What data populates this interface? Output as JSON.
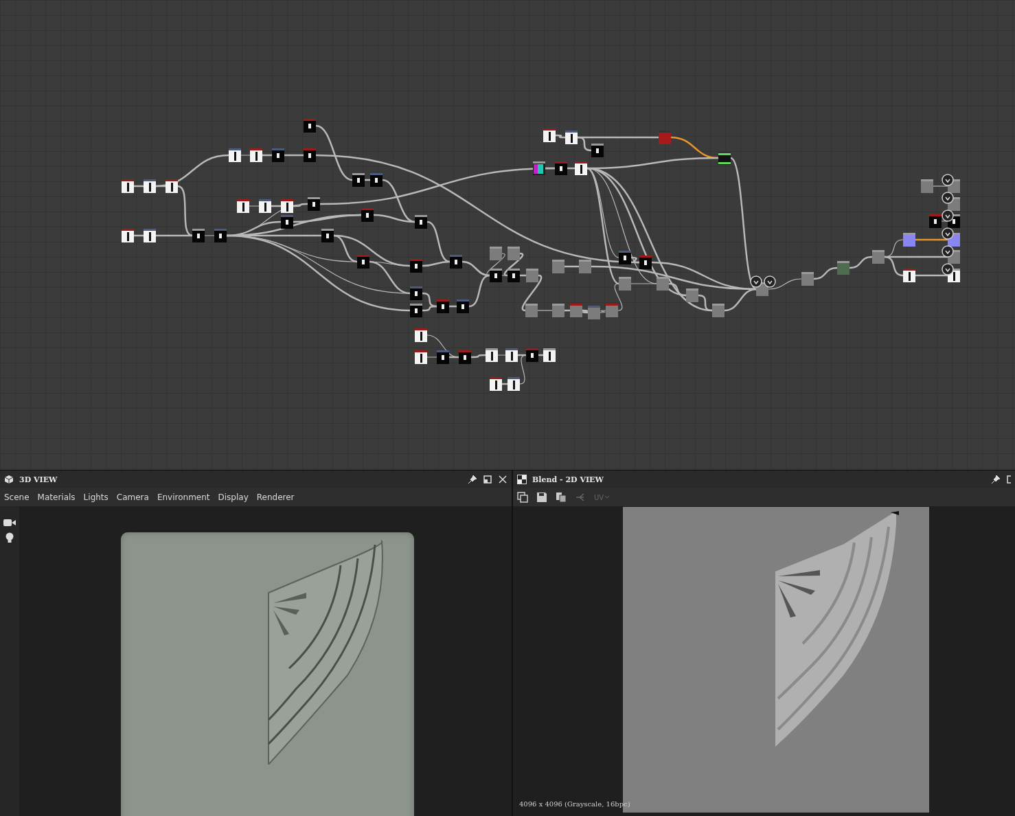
{
  "view_3d": {
    "title": "3D VIEW",
    "menu": [
      {
        "label": "Scene"
      },
      {
        "label": "Materials"
      },
      {
        "label": "Lights"
      },
      {
        "label": "Camera"
      },
      {
        "label": "Environment"
      },
      {
        "label": "Display"
      },
      {
        "label": "Renderer"
      }
    ]
  },
  "view_2d": {
    "title": "Blend - 2D VIEW",
    "uv_button": {
      "label": "UV",
      "disabled": true
    },
    "status": "4096 x 4096 (Grayscale, 16bpc)"
  }
}
